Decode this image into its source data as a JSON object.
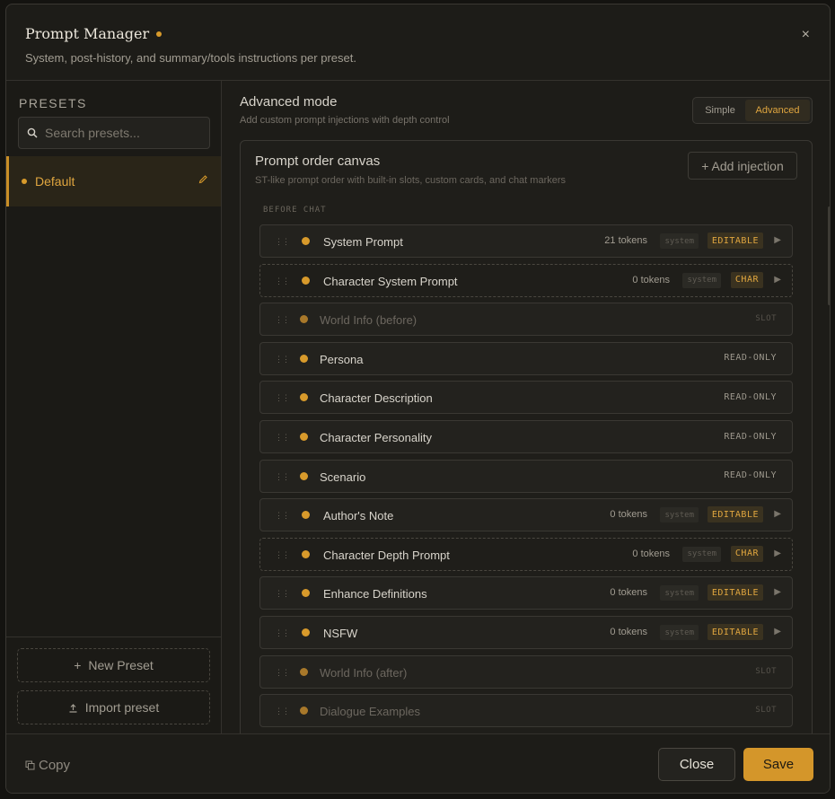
{
  "modal": {
    "title": "Prompt Manager",
    "subtitle": "System, post-history, and summary/tools instructions per preset.",
    "close_glyph": "×"
  },
  "sidebar": {
    "presets_label": "PRESETS",
    "search_placeholder": "Search presets...",
    "presets": [
      {
        "name": "Default",
        "selected": true
      }
    ],
    "new_preset": "New Preset",
    "import_preset": "Import preset"
  },
  "main": {
    "mode_title": "Advanced mode",
    "mode_subtitle": "Add custom prompt injections with depth control",
    "toggle": {
      "simple": "Simple",
      "advanced": "Advanced",
      "selected": "Advanced"
    },
    "canvas": {
      "title": "Prompt order canvas",
      "subtitle": "ST-like prompt order with built-in slots, custom cards, and chat markers",
      "add_injection": "+ Add injection",
      "section_label": "BEFORE CHAT",
      "rows": [
        {
          "label": "System Prompt",
          "tokens": "21 tokens",
          "role": "system",
          "badge": "EDITABLE",
          "kind": "edit"
        },
        {
          "label": "Character System Prompt",
          "tokens": "0 tokens",
          "role": "system",
          "badge": "CHAR",
          "kind": "char"
        },
        {
          "label": "World Info (before)",
          "badge": "SLOT",
          "kind": "slot"
        },
        {
          "label": "Persona",
          "badge": "READ-ONLY",
          "kind": "ro"
        },
        {
          "label": "Character Description",
          "badge": "READ-ONLY",
          "kind": "ro"
        },
        {
          "label": "Character Personality",
          "badge": "READ-ONLY",
          "kind": "ro"
        },
        {
          "label": "Scenario",
          "badge": "READ-ONLY",
          "kind": "ro"
        },
        {
          "label": "Author's Note",
          "tokens": "0 tokens",
          "role": "system",
          "badge": "EDITABLE",
          "kind": "edit"
        },
        {
          "label": "Character Depth Prompt",
          "tokens": "0 tokens",
          "role": "system",
          "badge": "CHAR",
          "kind": "char"
        },
        {
          "label": "Enhance Definitions",
          "tokens": "0 tokens",
          "role": "system",
          "badge": "EDITABLE",
          "kind": "edit"
        },
        {
          "label": "NSFW",
          "tokens": "0 tokens",
          "role": "system",
          "badge": "EDITABLE",
          "kind": "edit"
        },
        {
          "label": "World Info (after)",
          "badge": "SLOT",
          "kind": "slot"
        },
        {
          "label": "Dialogue Examples",
          "badge": "SLOT",
          "kind": "slot"
        }
      ]
    }
  },
  "footer": {
    "copy": "Copy",
    "close": "Close",
    "save": "Save"
  },
  "colors": {
    "accent": "#d4962a",
    "background": "#1d1c18"
  }
}
